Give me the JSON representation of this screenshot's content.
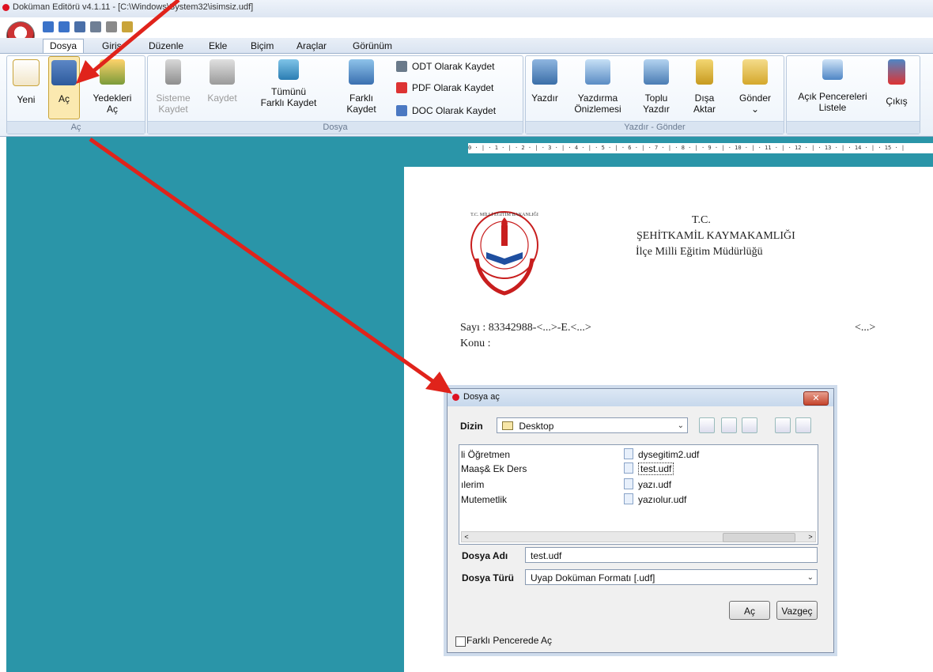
{
  "window": {
    "title": "Doküman Editörü v4.1.11 - [C:\\Windows\\System32\\isimsiz.udf]"
  },
  "tabs": [
    "Dosya",
    "Giriş",
    "Düzenle",
    "Ekle",
    "Biçim",
    "Araçlar",
    "Görünüm"
  ],
  "ribbon": {
    "group_ac": {
      "label": "Aç",
      "yeni": "Yeni",
      "ac": "Aç",
      "yedekleri_1": "Yedekleri",
      "yedekleri_2": "Aç"
    },
    "group_dosya": {
      "label": "Dosya",
      "sisteme_1": "Sisteme",
      "sisteme_2": "Kaydet",
      "kaydet": "Kaydet",
      "tumunu_1": "Tümünü",
      "tumunu_2": "Farklı Kaydet",
      "farkli_1": "Farklı",
      "farkli_2": "Kaydet",
      "odt": "ODT Olarak Kaydet",
      "pdf": "PDF Olarak Kaydet",
      "doc": "DOC Olarak Kaydet"
    },
    "group_yazdir": {
      "label": "Yazdır - Gönder",
      "yazdir": "Yazdır",
      "onizleme_1": "Yazdırma",
      "onizleme_2": "Önizlemesi",
      "toplu_1": "Toplu",
      "toplu_2": "Yazdır",
      "disa_1": "Dışa",
      "disa_2": "Aktar",
      "gonder": "Gönder",
      "gonder_arrow": "⌄"
    },
    "group_pencere": {
      "acik_1": "Açık Pencereleri",
      "acik_2": "Listele",
      "cikis": "Çıkış"
    }
  },
  "ruler": "0 · | · 1 · | · 2 · | · 3 · | · 4 · | · 5 · | · 6 · | · 7 · | · 8 · | · 9 · | · 10 · | · 11 · | · 12 · | · 13 · | · 14 · | · 15 · |",
  "document": {
    "header_1": "T.C.",
    "header_2": "ŞEHİTKAMİL KAYMAKAMLIĞI",
    "header_3": "İlçe Milli Eğitim Müdürlüğü",
    "sayi": "Sayı  : 83342988-<...>-E.<...>",
    "sayi_right": "<...>",
    "konu": "Konu :",
    "logo_text": "T.C. MİLLİ EĞİTİM BAKANLIĞI"
  },
  "dialog": {
    "title": "Dosya aç",
    "close": "✕",
    "dizin_label": "Dizin",
    "dizin_value": "Desktop",
    "files_left": [
      "li Öğretmen",
      "Maaş& Ek Ders",
      "ılerim",
      "Mutemetlik"
    ],
    "files_right": [
      "dysegitim2.udf",
      "test.udf",
      "yazı.udf",
      "yazıolur.udf"
    ],
    "dosya_adi_label": "Dosya Adı",
    "dosya_adi_value": "test.udf",
    "dosya_turu_label": "Dosya Türü",
    "dosya_turu_value": "Uyap Doküman Formatı [.udf]",
    "ac_button": "Aç",
    "vazgec_button": "Vazgeç",
    "farkli_pencere": "Farklı Pencerede Aç"
  },
  "colors": {
    "workspace": "#2a95a8",
    "arrow": "#e0231b"
  }
}
